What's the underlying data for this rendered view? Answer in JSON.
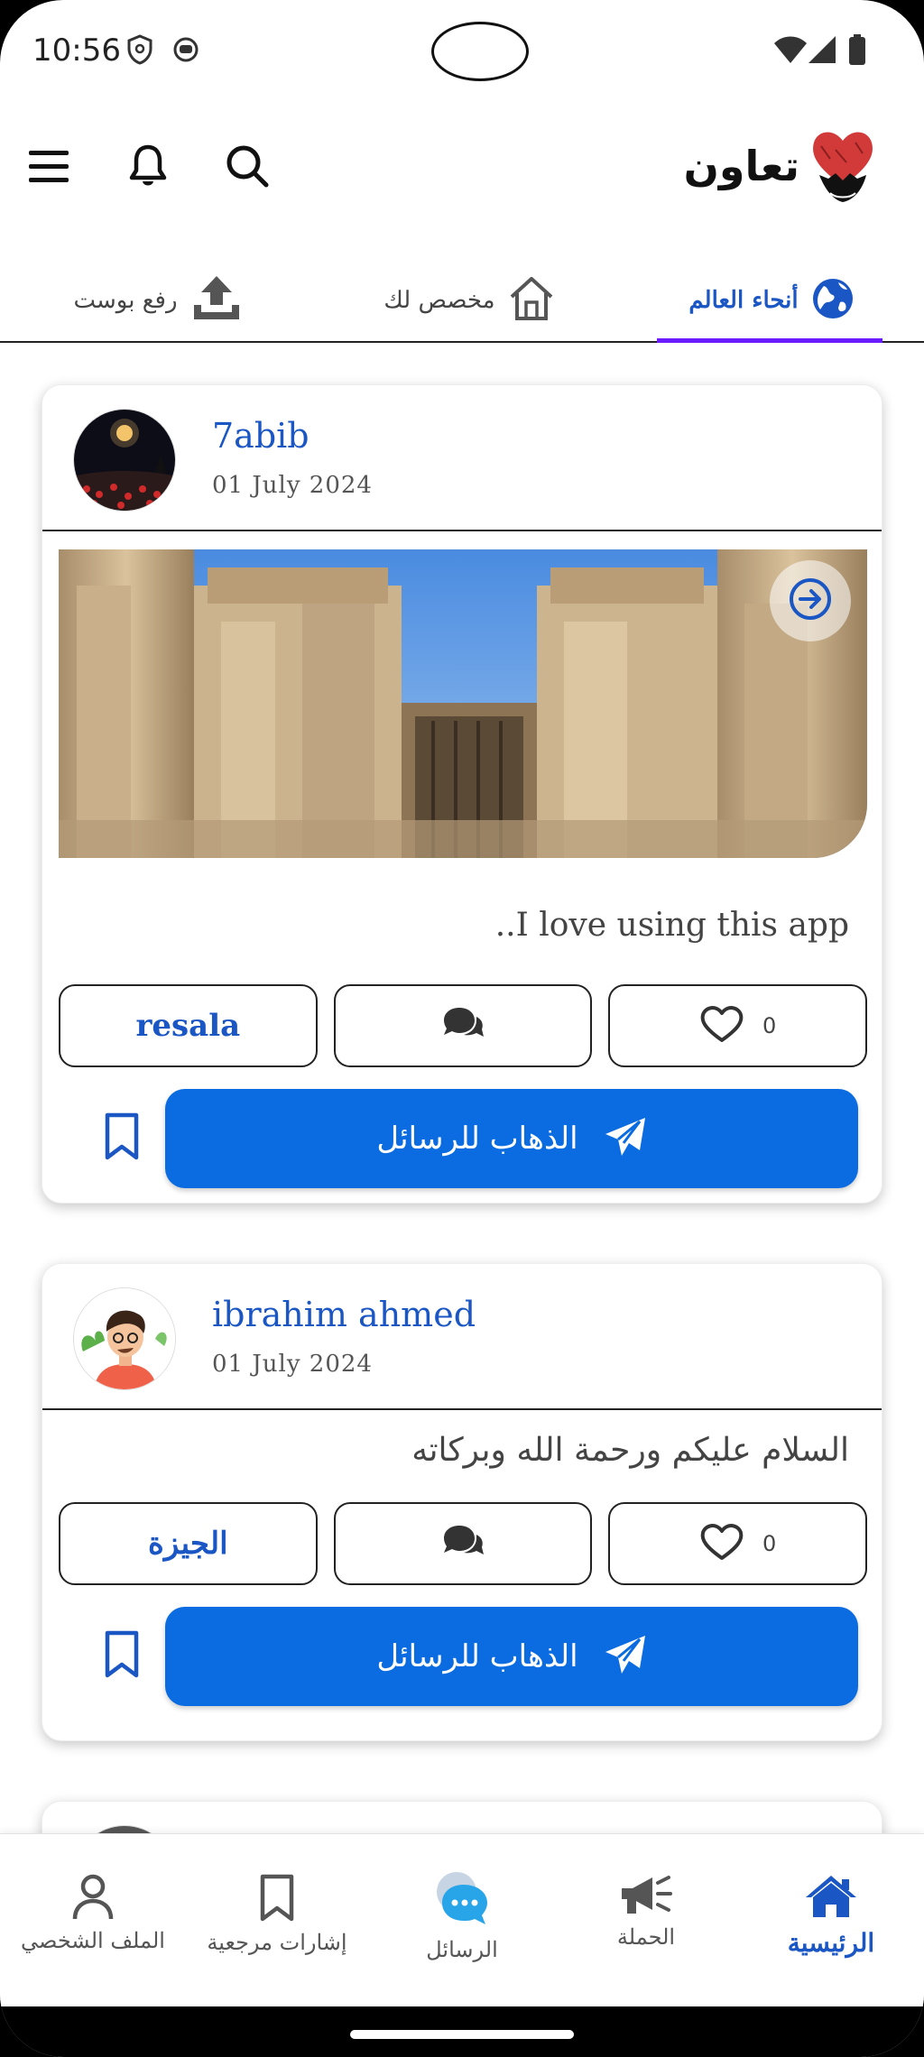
{
  "status_bar": {
    "time": "10:56"
  },
  "app_bar": {
    "brand_name": "تعاون"
  },
  "tabs": [
    {
      "label": "رفع بوست",
      "icon": "upload-icon"
    },
    {
      "label": "مخصص لك",
      "icon": "home-outline-icon"
    },
    {
      "label": "أنحاء العالم",
      "icon": "globe-icon",
      "active": true
    }
  ],
  "posts": [
    {
      "author": "7abib",
      "date": "01 July 2024",
      "text": "I love using this app..",
      "tag": "resala",
      "likes": "0",
      "cta_label": "الذهاب للرسائل"
    },
    {
      "author": "ibrahim ahmed",
      "date": "01 July 2024",
      "text": "السلام عليكم ورحمة الله وبركاته",
      "tag": "الجيزة",
      "likes": "0",
      "cta_label": "الذهاب للرسائل"
    }
  ],
  "bottom_nav": [
    {
      "label": "الملف الشخصي",
      "icon": "person-icon"
    },
    {
      "label": "إشارات مرجعية",
      "icon": "bookmark-icon"
    },
    {
      "label": "الرسائل",
      "icon": "chat-bubbles-icon"
    },
    {
      "label": "الحملة",
      "icon": "megaphone-icon"
    },
    {
      "label": "الرئيسية",
      "icon": "home-icon",
      "active": true
    }
  ],
  "colors": {
    "accent": "#1a56c4",
    "cta": "#0a6ce0",
    "tab_indicator": "#6a1bff"
  }
}
